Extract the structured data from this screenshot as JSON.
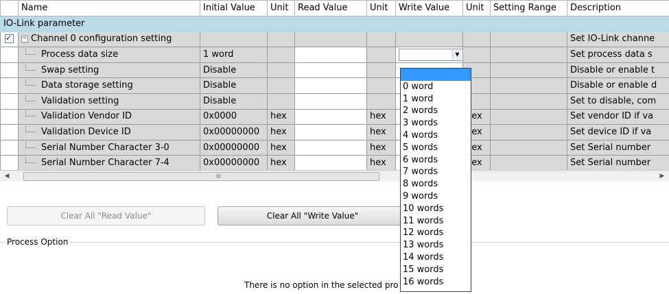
{
  "columns": [
    "",
    "Name",
    "Initial Value",
    "Unit",
    "Read Value",
    "Unit",
    "Write Value",
    "Unit",
    "Setting Range",
    "Description"
  ],
  "section_label": "IO-Link parameter",
  "group": {
    "name": "Channel 0 configuration setting",
    "description": "Set IO-Link channe",
    "checked": true
  },
  "rows": [
    {
      "name": "Process data size",
      "initial": "1 word",
      "unit": "",
      "read": "",
      "read_unit": "",
      "write": "",
      "write_unit": "",
      "range": "",
      "description": "Set process data s"
    },
    {
      "name": "Swap setting",
      "initial": "Disable",
      "unit": "",
      "read": "",
      "read_unit": "",
      "write": "",
      "write_unit": "",
      "range": "",
      "description": "Disable or enable t"
    },
    {
      "name": "Data storage setting",
      "initial": "Disable",
      "unit": "",
      "read": "",
      "read_unit": "",
      "write": "",
      "write_unit": "",
      "range": "",
      "description": "Disable or enable d"
    },
    {
      "name": "Validation setting",
      "initial": "Disable",
      "unit": "",
      "read": "",
      "read_unit": "",
      "write": "",
      "write_unit": "",
      "range": "",
      "description": "Set to disable, com"
    },
    {
      "name": "Validation Vendor ID",
      "initial": "0x0000",
      "unit": "hex",
      "read": "",
      "read_unit": "hex",
      "write": "",
      "write_unit": "hex",
      "range": "",
      "description": "Set vendor ID if va"
    },
    {
      "name": "Validation Device ID",
      "initial": "0x00000000",
      "unit": "hex",
      "read": "",
      "read_unit": "hex",
      "write": "",
      "write_unit": "hex",
      "range": "",
      "description": "Set device ID if va"
    },
    {
      "name": "Serial Number Character 3-0",
      "initial": "0x00000000",
      "unit": "hex",
      "read": "",
      "read_unit": "hex",
      "write": "",
      "write_unit": "hex",
      "range": "",
      "description": "Set Serial number"
    },
    {
      "name": "Serial Number Character 7-4",
      "initial": "0x00000000",
      "unit": "hex",
      "read": "",
      "read_unit": "hex",
      "write": "",
      "write_unit": "hex",
      "range": "",
      "description": "Set Serial number"
    }
  ],
  "dropdown_options": [
    "",
    "0 word",
    "1 word",
    "2 words",
    "3 words",
    "4 words",
    "5 words",
    "6 words",
    "7 words",
    "8 words",
    "9 words",
    "10 words",
    "11 words",
    "12 words",
    "13 words",
    "14 words",
    "15 words",
    "16 words"
  ],
  "buttons": {
    "clear_read": "Clear All \"Read Value\"",
    "clear_write": "Clear All \"Write Value\""
  },
  "scroll_grip": "III",
  "process_option": {
    "label": "Process Option",
    "message": "There is no option in the selected pro"
  },
  "colors": {
    "section_bg": "#bcd9e8",
    "cell_bg": "#d9d9d9",
    "selected_option": "#3399ff"
  }
}
